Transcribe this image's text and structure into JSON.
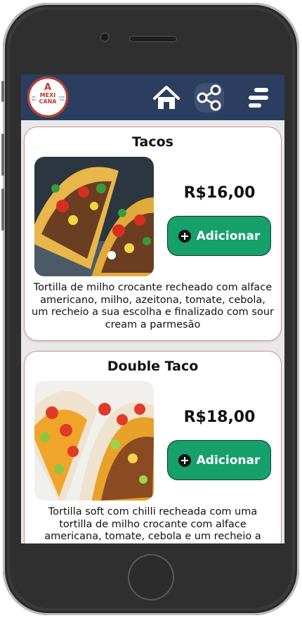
{
  "header": {
    "logo": {
      "letter": "A",
      "main_text": "MEXI CANA",
      "side_left": "TEX MEX",
      "side_right": "FOOD BAR"
    },
    "icons": [
      "home-icon",
      "share-icon",
      "menu-icon"
    ],
    "background_color": "#2b3e5f"
  },
  "products": [
    {
      "title": "Tacos",
      "price": "R$16,00",
      "button_label": "Adicionar",
      "description": "Tortilla de milho crocante recheado com alface americano, milho, azeitona, tomate, cebola, um recheio a sua escolha e finalizado com sour cream a parmesão"
    },
    {
      "title": "Double Taco",
      "price": "R$18,00",
      "button_label": "Adicionar",
      "description": "Tortilla soft com chilli recheada com uma tortilla de milho crocante com alface americana, tomate, cebola e um recheio a"
    }
  ],
  "colors": {
    "accent_button": "#16a06a",
    "card_border": "#d48c8c",
    "screen_background": "#e8e8e8"
  }
}
